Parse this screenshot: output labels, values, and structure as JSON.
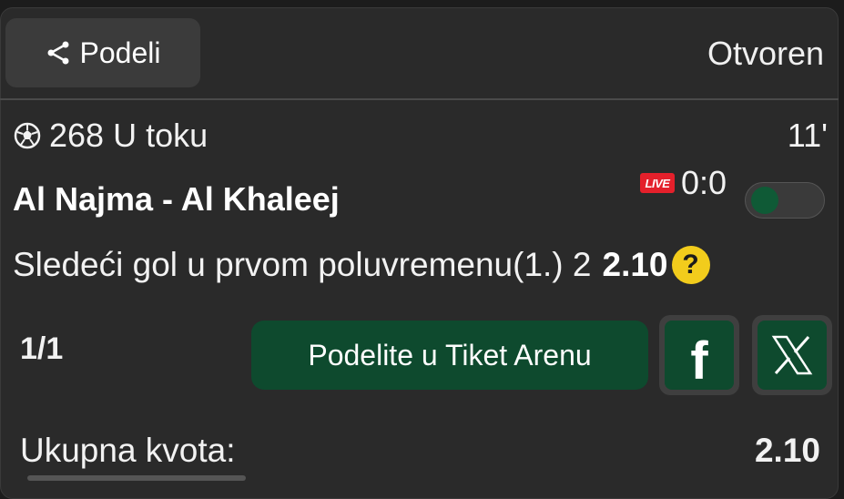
{
  "header": {
    "share_label": "Podeli",
    "status": "Otvoren"
  },
  "match": {
    "code_status": "268 U toku",
    "minute": "11'",
    "teams": "Al Najma - Al Khaleej",
    "live_badge": "LIVE",
    "score": "0:0"
  },
  "bet": {
    "market": "Sledeći gol u prvom poluvremenu(1.) 2",
    "odds": "2.10",
    "help": "?"
  },
  "ticket": {
    "count": "1/1",
    "arena_button": "Podelite u Tiket Arenu",
    "facebook_glyph": "f",
    "x_icon": "x-logo-icon"
  },
  "summary": {
    "total_label": "Ukupna kvota:",
    "total_value": "2.10"
  },
  "colors": {
    "background": "#2a2a2a",
    "accent_green": "#0e4a2e",
    "live_red": "#e4202b",
    "help_yellow": "#f2cc1c"
  }
}
